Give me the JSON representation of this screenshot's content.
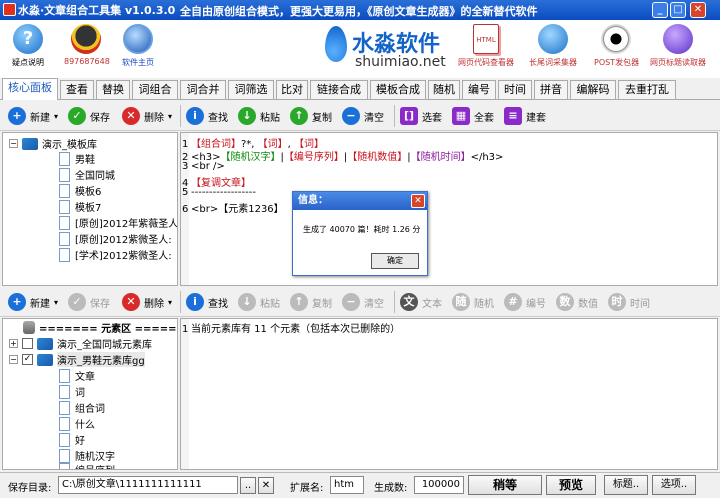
{
  "window": {
    "title": "水淼·文章组合工具集 v1.0.3.0",
    "slogan": "全自由原创组合模式，更强大更易用，《原创文章生成器》的全新替代软件",
    "min": "_",
    "max": "□",
    "close": "✕"
  },
  "toolbar": {
    "items": [
      {
        "label": "疑点说明",
        "icon": "help-icon"
      },
      {
        "label": "897687648",
        "icon": "qq-icon"
      },
      {
        "label": "软件主页",
        "icon": "globe-icon"
      },
      {
        "label": "网页代码查看器",
        "icon": "html-file-icon"
      },
      {
        "label": "长尾词采集器",
        "icon": "search-icon"
      },
      {
        "label": "POST发包器",
        "icon": "eye-icon"
      },
      {
        "label": "网页标题读取器",
        "icon": "reader-icon"
      }
    ],
    "logo_main": "水淼软件",
    "logo_sub": "shuimiao.net"
  },
  "tabs": [
    "核心面板",
    "查看",
    "替换",
    "词组合",
    "词合并",
    "词筛选",
    "比对",
    "链接合成",
    "模板合成",
    "随机",
    "编号",
    "时间",
    "拼音",
    "编解码",
    "去重打乱"
  ],
  "upper_toolbar": {
    "new": "新建",
    "save": "保存",
    "delete": "删除",
    "find": "查找",
    "paste": "粘贴",
    "copy": "复制",
    "clear": "清空",
    "select_item": "选套",
    "select_all": "全套",
    "build": "建套"
  },
  "template_tree": {
    "root": "演示_模板库",
    "items": [
      "男鞋",
      "全国同城",
      "模板6",
      "模板7",
      "[原创]2012年紫薇圣人",
      "[原创]2012紫微圣人:",
      "[学术]2012紫微圣人:"
    ]
  },
  "editor": {
    "lines": [
      {
        "n": "1",
        "parts": [
          {
            "t": "【组合词】",
            "c": "red"
          },
          {
            "t": "?*, ",
            "c": ""
          },
          {
            "t": "【词】",
            "c": "red"
          },
          {
            "t": ", ",
            "c": ""
          },
          {
            "t": "【词】",
            "c": "red"
          }
        ]
      },
      {
        "n": "2",
        "parts": [
          {
            "t": "<h3>",
            "c": ""
          },
          {
            "t": "【随机汉字】",
            "c": "green"
          },
          {
            "t": "|",
            "c": ""
          },
          {
            "t": "【编号序列】",
            "c": "red"
          },
          {
            "t": "|",
            "c": ""
          },
          {
            "t": "【随机数值】",
            "c": "red"
          },
          {
            "t": "|",
            "c": ""
          },
          {
            "t": "【随机时间】",
            "c": "purple"
          },
          {
            "t": "</h3>",
            "c": ""
          }
        ]
      },
      {
        "n": "3",
        "parts": [
          {
            "t": "<br />",
            "c": ""
          }
        ]
      },
      {
        "n": "4",
        "parts": [
          {
            "t": "【复调文章】",
            "c": "red"
          }
        ]
      },
      {
        "n": "5",
        "parts": [
          {
            "t": "------------------",
            "c": ""
          }
        ]
      },
      {
        "n": "6",
        "parts": [
          {
            "t": "<br>【元素1236】",
            "c": ""
          }
        ]
      }
    ]
  },
  "dialog": {
    "title": "信息：",
    "message": "生成了 40070 篇！耗时 1.26 分",
    "ok": "确定",
    "close": "✕"
  },
  "lower_toolbar": {
    "new": "新建",
    "save": "保存",
    "delete": "删除",
    "find": "查找",
    "paste": "粘贴",
    "copy": "复制",
    "clear": "清空",
    "text": "文本",
    "random": "随机",
    "number": "编号",
    "value": "数值",
    "time": "时间"
  },
  "element_tree": {
    "header": "======= 元素区 =======",
    "group1": "演示_全国同城元素库",
    "group2": "演示_男鞋元素库gg",
    "items": [
      "文章",
      "词",
      "组合词",
      "什么",
      "好",
      "随机汉字",
      "编号序列"
    ]
  },
  "element_editor": {
    "line_no": "1",
    "text": "当前元素库有 11 个元素（包括本次已删除的）"
  },
  "statusbar": {
    "save_dir_label": "保存目录:",
    "save_dir_value": "C:\\原创文章\\1111111111111",
    "browse": "..",
    "clear": "✕",
    "ext_label": "扩展名:",
    "ext_value": "htm",
    "count_label": "生成数:",
    "count_value": "100000",
    "wait_btn": "稍等",
    "preview_btn": "预览",
    "title_btn": "标题..",
    "options_btn": "选项.."
  }
}
